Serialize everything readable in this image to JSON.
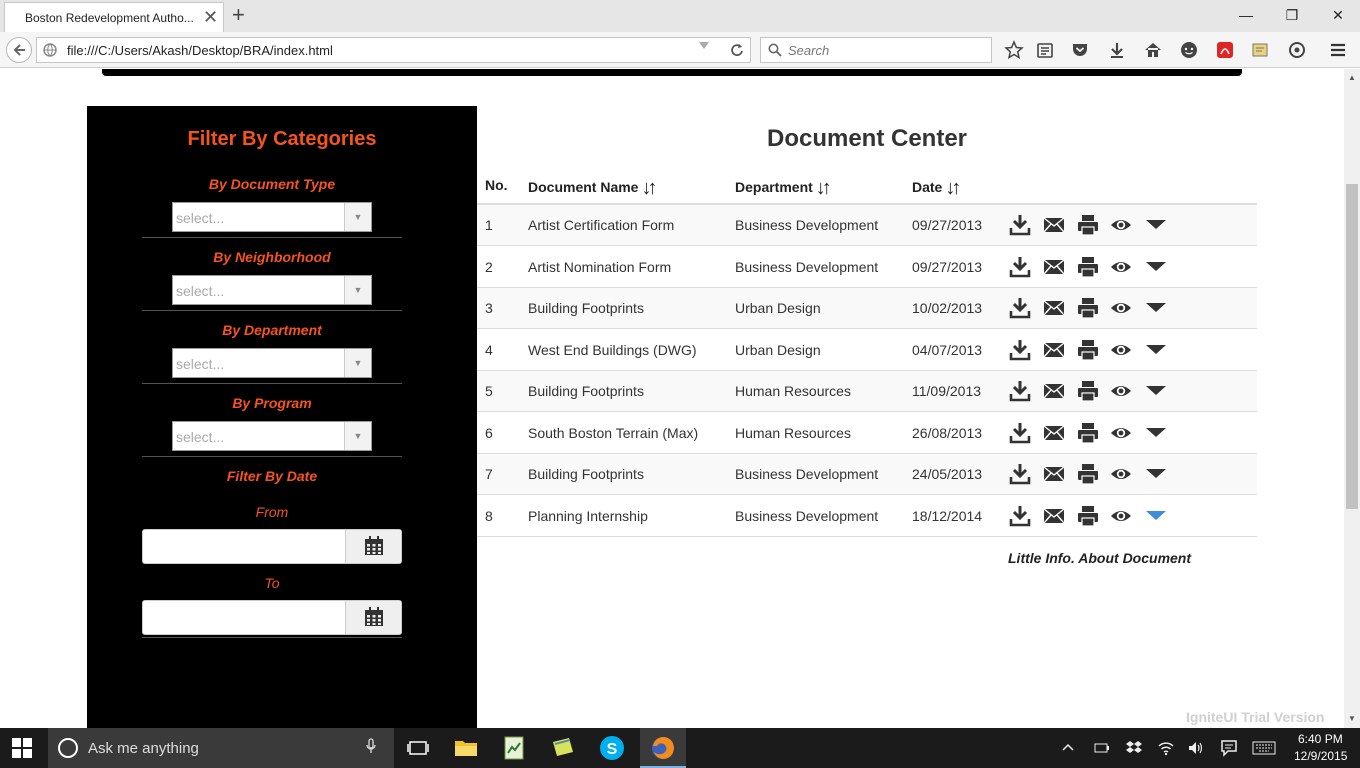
{
  "browser": {
    "tab_title": "Boston Redevelopment Autho...",
    "tab_close": "✕",
    "new_tab": "+",
    "url": "file:///C:/Users/Akash/Desktop/BRA/index.html",
    "search_placeholder": "Search",
    "window_minimize": "—",
    "window_restore": "❐",
    "window_close": "✕"
  },
  "sidebar": {
    "title": "Filter By Categories",
    "filters": [
      {
        "label": "By Document Type",
        "placeholder": "select..."
      },
      {
        "label": "By Neighborhood",
        "placeholder": "select..."
      },
      {
        "label": "By Department",
        "placeholder": "select..."
      },
      {
        "label": "By Program",
        "placeholder": "select..."
      }
    ],
    "date_filter": {
      "label": "Filter By Date",
      "from_label": "From",
      "to_label": "To",
      "from_value": "",
      "to_value": ""
    }
  },
  "main": {
    "title": "Document Center",
    "columns": {
      "no": "No.",
      "name": "Document Name",
      "department": "Department",
      "date": "Date"
    },
    "sort_icon": "↓↑",
    "rows": [
      {
        "no": "1",
        "name": "Artist Certification Form",
        "department": "Business Development",
        "date": "09/27/2013"
      },
      {
        "no": "2",
        "name": "Artist Nomination Form",
        "department": "Business Development",
        "date": "09/27/2013"
      },
      {
        "no": "3",
        "name": "Building Footprints",
        "department": "Urban Design",
        "date": "10/02/2013"
      },
      {
        "no": "4",
        "name": "West End Buildings (DWG)",
        "department": "Urban Design",
        "date": "04/07/2013"
      },
      {
        "no": "5",
        "name": "Building Footprints",
        "department": "Human Resources",
        "date": "11/09/2013"
      },
      {
        "no": "6",
        "name": "South Boston Terrain (Max)",
        "department": "Human Resources",
        "date": "26/08/2013"
      },
      {
        "no": "7",
        "name": "Building Footprints",
        "department": "Business Development",
        "date": "24/05/2013"
      },
      {
        "no": "8",
        "name": "Planning Internship",
        "department": "Business Development",
        "date": "18/12/2014"
      }
    ],
    "expanded_row_info": "Little Info. About Document",
    "trial_notice": "IgniteUI Trial Version"
  },
  "colors": {
    "accent": "#f5541f",
    "expanded_arrow": "#3a8fd6"
  },
  "taskbar": {
    "search_placeholder": "Ask me anything",
    "time": "6:40 PM",
    "date": "12/9/2015"
  }
}
